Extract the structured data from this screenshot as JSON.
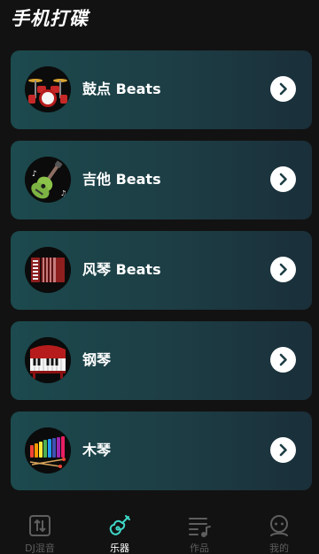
{
  "app": {
    "title": "手机打碟"
  },
  "instruments": [
    {
      "label": "鼓点 Beats",
      "icon": "drum-kit-icon"
    },
    {
      "label": "吉他 Beats",
      "icon": "guitar-icon"
    },
    {
      "label": "风琴 Beats",
      "icon": "accordion-icon"
    },
    {
      "label": "钢琴",
      "icon": "piano-icon"
    },
    {
      "label": "木琴",
      "icon": "xylophone-icon"
    }
  ],
  "tabbar": {
    "tabs": [
      {
        "label": "DJ混音",
        "icon": "mixer-icon"
      },
      {
        "label": "乐器",
        "icon": "guitar-icon"
      },
      {
        "label": "作品",
        "icon": "playlist-icon"
      },
      {
        "label": "我的",
        "icon": "profile-icon"
      }
    ],
    "active_index": 1
  },
  "colors": {
    "background": "#121212",
    "card_gradient_start": "#1c4a4e",
    "card_gradient_end": "#1a2f3a",
    "accent_active": "#3fd8c8",
    "inactive": "#5e5e5e"
  }
}
